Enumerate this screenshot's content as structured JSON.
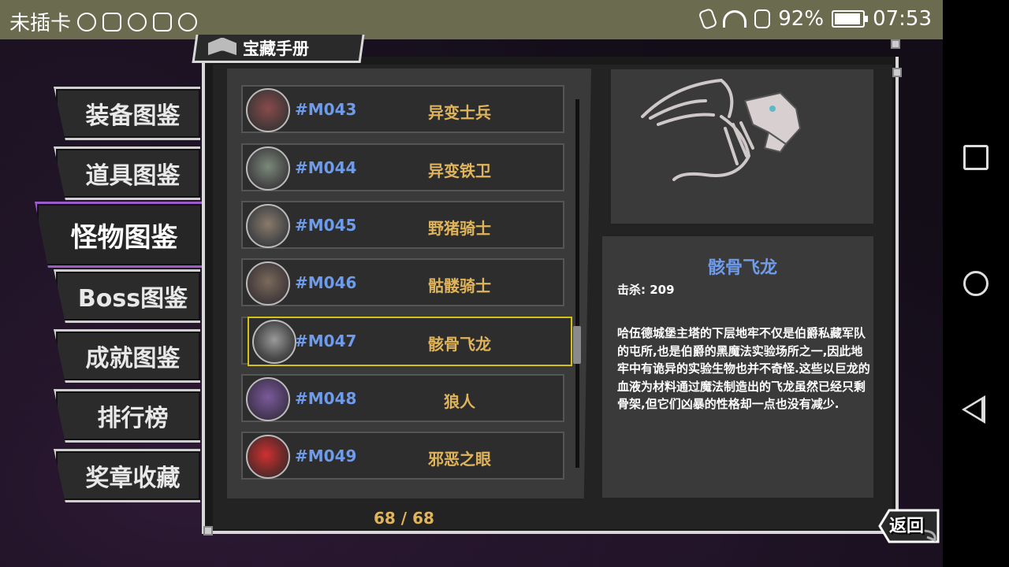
{
  "status_bar": {
    "carrier": "未插卡",
    "battery": "92%",
    "time": "07:53"
  },
  "header": {
    "title": "宝藏手册"
  },
  "tabs": [
    {
      "label": "装备图鉴",
      "active": false
    },
    {
      "label": "道具图鉴",
      "active": false
    },
    {
      "label": "怪物图鉴",
      "active": true
    },
    {
      "label": "Boss图鉴",
      "active": false
    },
    {
      "label": "成就图鉴",
      "active": false
    },
    {
      "label": "排行榜",
      "active": false
    },
    {
      "label": "奖章收藏",
      "active": false
    }
  ],
  "monsters": [
    {
      "code": "#M043",
      "name": "异变士兵"
    },
    {
      "code": "#M044",
      "name": "异变铁卫"
    },
    {
      "code": "#M045",
      "name": "野猪骑士"
    },
    {
      "code": "#M046",
      "name": "骷髅骑士"
    },
    {
      "code": "#M047",
      "name": "骸骨飞龙",
      "selected": true
    },
    {
      "code": "#M048",
      "name": "狼人"
    },
    {
      "code": "#M049",
      "name": "邪恶之眼"
    }
  ],
  "pagination": {
    "text": "68 / 68"
  },
  "detail": {
    "name": "骸骨飞龙",
    "kills": "击杀: 209",
    "description": "哈伍德城堡主塔的下层地牢不仅是伯爵私藏军队的屯所,也是伯爵的黑魔法实验场所之一,因此地牢中有诡异的实验生物也并不奇怪.这些以巨龙的血液为材料通过魔法制造出的飞龙虽然已经只剩骨架,但它们凶暴的性格却一点也没有减少."
  },
  "back_button": {
    "label": "返回"
  },
  "colors": {
    "accent_purple": "#9b5cc9",
    "highlight_yellow": "#d4c21a",
    "code_blue": "#6e9bea",
    "name_gold": "#e0b45a"
  }
}
